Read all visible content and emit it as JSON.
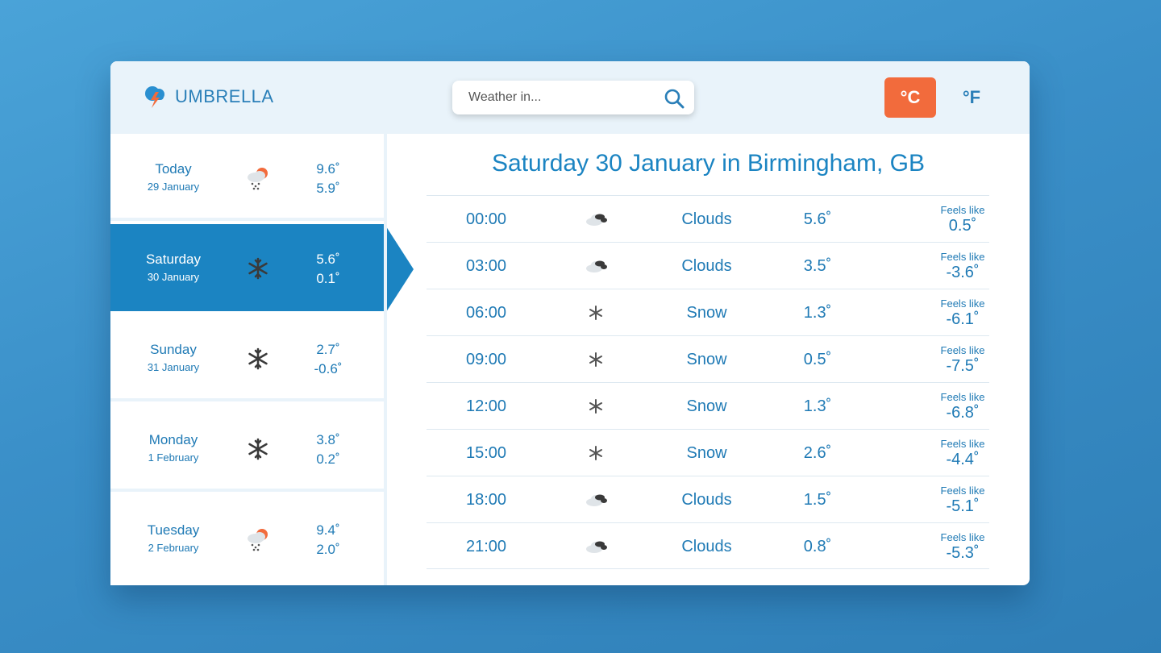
{
  "header": {
    "logo_text": "UMBRELLA",
    "search_placeholder": "Weather in...",
    "unit_celsius": "°C",
    "unit_fahrenheit": "°F",
    "active_unit": "C"
  },
  "days": [
    {
      "name": "Today",
      "date": "29 January",
      "icon": "rain-sun-icon",
      "high": "9.6˚",
      "low": "5.9˚",
      "active": false
    },
    {
      "name": "Saturday",
      "date": "30 January",
      "icon": "snowflake-icon",
      "high": "5.6˚",
      "low": "0.1˚",
      "active": true
    },
    {
      "name": "Sunday",
      "date": "31 January",
      "icon": "snowflake-icon",
      "high": "2.7˚",
      "low": "-0.6˚",
      "active": false
    },
    {
      "name": "Monday",
      "date": "1 February",
      "icon": "snowflake-icon",
      "high": "3.8˚",
      "low": "0.2˚",
      "active": false
    },
    {
      "name": "Tuesday",
      "date": "2 February",
      "icon": "rain-sun-icon",
      "high": "9.4˚",
      "low": "2.0˚",
      "active": false
    }
  ],
  "main": {
    "title": "Saturday 30 January in Birmingham, GB",
    "feels_like_label": "Feels like",
    "rows": [
      {
        "time": "00:00",
        "icon": "clouds-icon",
        "desc": "Clouds",
        "temp": "5.6˚",
        "feels": "0.5˚"
      },
      {
        "time": "03:00",
        "icon": "clouds-icon",
        "desc": "Clouds",
        "temp": "3.5˚",
        "feels": "-3.6˚"
      },
      {
        "time": "06:00",
        "icon": "snow-icon",
        "desc": "Snow",
        "temp": "1.3˚",
        "feels": "-6.1˚"
      },
      {
        "time": "09:00",
        "icon": "snow-icon",
        "desc": "Snow",
        "temp": "0.5˚",
        "feels": "-7.5˚"
      },
      {
        "time": "12:00",
        "icon": "snow-icon",
        "desc": "Snow",
        "temp": "1.3˚",
        "feels": "-6.8˚"
      },
      {
        "time": "15:00",
        "icon": "snow-icon",
        "desc": "Snow",
        "temp": "2.6˚",
        "feels": "-4.4˚"
      },
      {
        "time": "18:00",
        "icon": "clouds-icon",
        "desc": "Clouds",
        "temp": "1.5˚",
        "feels": "-5.1˚"
      },
      {
        "time": "21:00",
        "icon": "clouds-icon",
        "desc": "Clouds",
        "temp": "0.8˚",
        "feels": "-5.3˚"
      }
    ]
  },
  "colors": {
    "primary": "#1b84c2",
    "accent": "#f26b3c",
    "header_bg": "#e9f3fa"
  }
}
